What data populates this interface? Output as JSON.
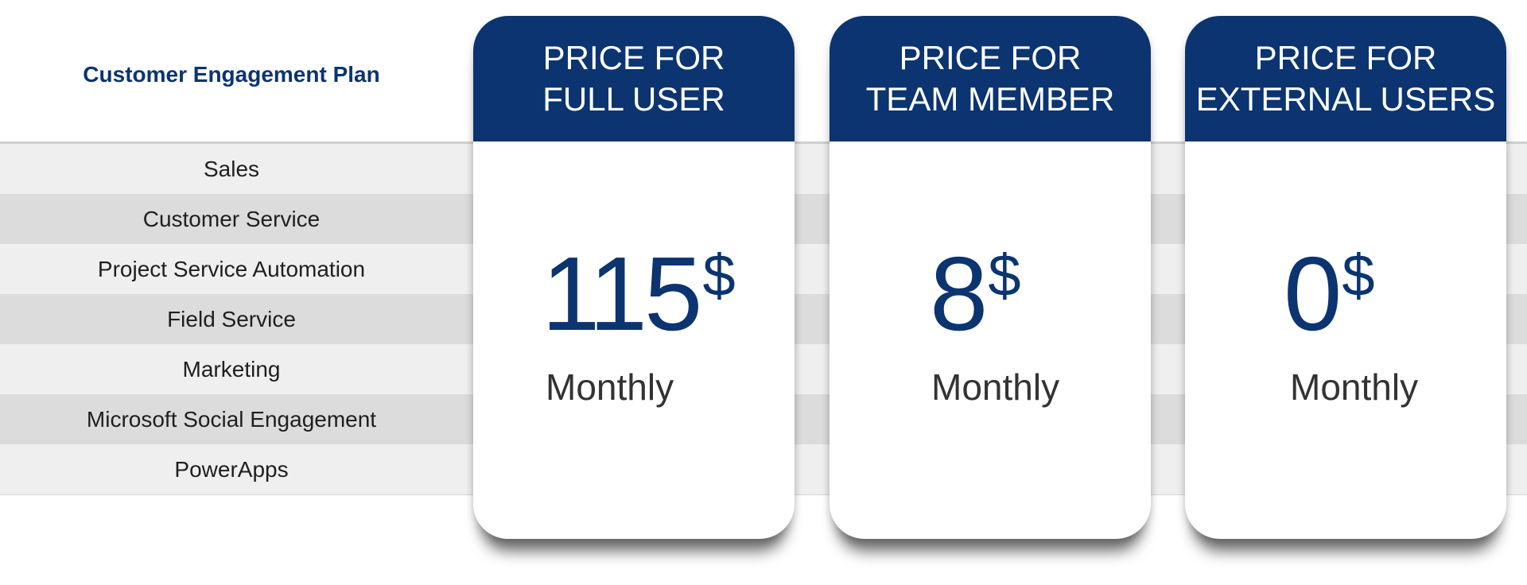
{
  "plan": {
    "title": "Customer Engagement Plan"
  },
  "features": [
    "Sales",
    "Customer Service",
    "Project Service Automation",
    "Field Service",
    "Marketing",
    "Microsoft Social Engagement",
    "PowerApps"
  ],
  "cards": [
    {
      "heading_line1": "PRICE FOR",
      "heading_line2": "FULL USER",
      "amount": "115",
      "currency": "$",
      "period": "Monthly"
    },
    {
      "heading_line1": "PRICE FOR",
      "heading_line2": "TEAM MEMBER",
      "amount": "8",
      "currency": "$",
      "period": "Monthly"
    },
    {
      "heading_line1": "PRICE FOR",
      "heading_line2": "EXTERNAL USERS",
      "amount": "0",
      "currency": "$",
      "period": "Monthly"
    }
  ],
  "colors": {
    "brand_navy": "#0b3470",
    "row_light": "#efefef",
    "row_dark": "#dcdcdc"
  }
}
